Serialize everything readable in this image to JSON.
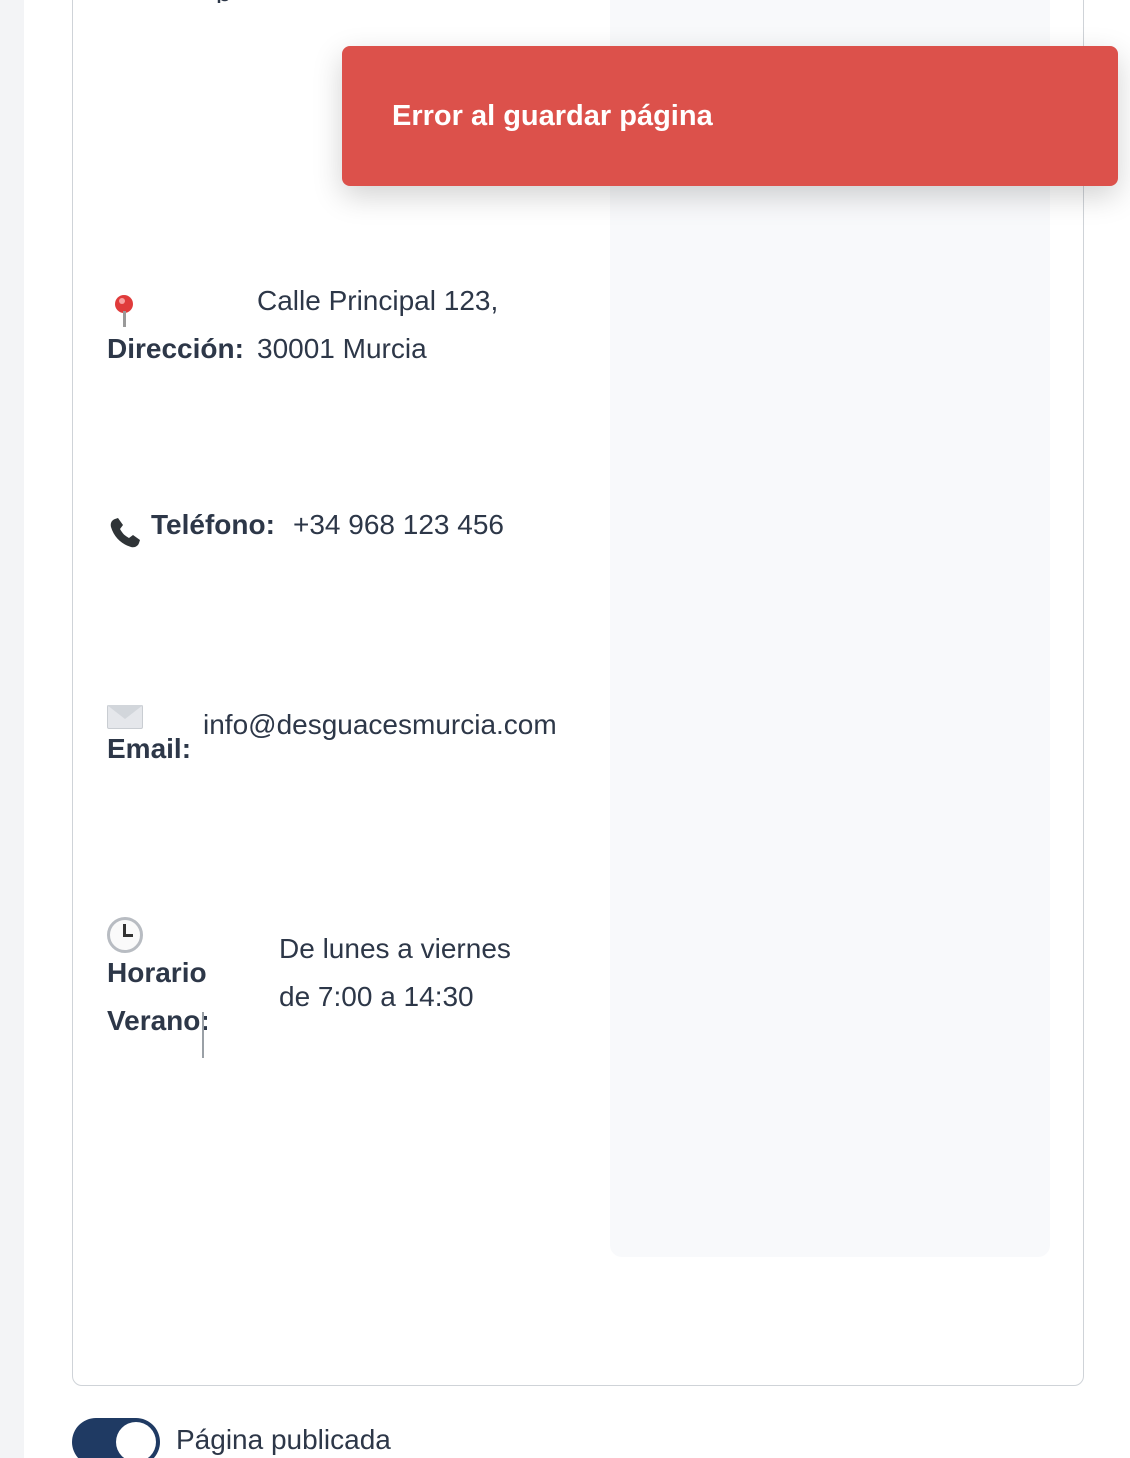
{
  "toast": {
    "message": "Error al guardar página",
    "color": "#dc514b"
  },
  "contact": {
    "address": {
      "icon": "pin-icon",
      "label": "Dirección:",
      "line1": "Calle Principal 123,",
      "line2": "30001 Murcia"
    },
    "phone": {
      "icon": "phone-icon",
      "label": "Teléfono:",
      "value": "+34 968 123 456"
    },
    "email": {
      "icon": "envelope-icon",
      "label": "Email:",
      "value": "info@desguacesmurcia.com"
    },
    "hours": {
      "icon": "clock-icon",
      "label_line1": "Horario",
      "label_line2": "Verano:",
      "line1": "De lunes a viernes",
      "line2": "de 7:00 a 14:30"
    }
  },
  "publish": {
    "label": "Página publicada",
    "enabled": true,
    "accent": "#1f3a63"
  }
}
